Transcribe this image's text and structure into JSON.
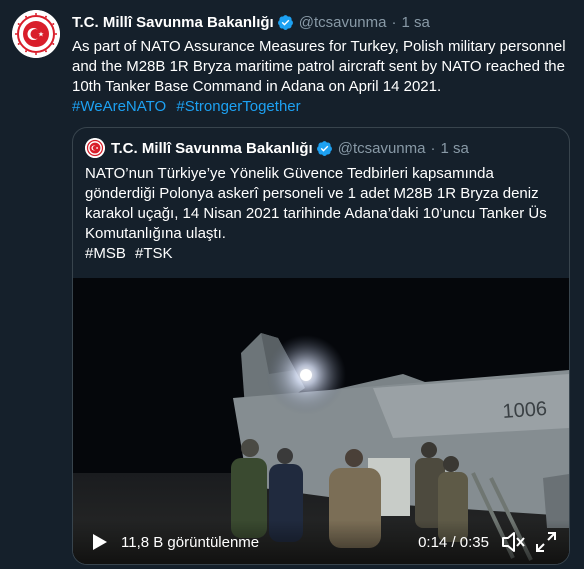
{
  "tweet": {
    "author_name": "T.C. Millî Savunma Bakanlığı",
    "handle": "@tcsavunma",
    "separator": "·",
    "time": "1 sa",
    "text": "As part of NATO Assurance Measures for Turkey, Polish military personnel and the M28B 1R Bryza maritime patrol aircraft sent by NATO reached the 10th Tanker Base Command in Adana on April 14 2021.",
    "hashtags": [
      "#WeAreNATO",
      "#StrongerTogether"
    ]
  },
  "quote": {
    "author_name": "T.C. Millî Savunma Bakanlığı",
    "handle": "@tcsavunma",
    "separator": "·",
    "time": "1 sa",
    "text": "NATO’nun Türkiye’ye Yönelik Güvence Tedbirleri kapsamında gönderdiği Polonya askerî personeli ve 1 adet M28B 1R Bryza deniz karakol uçağı, 14 Nisan 2021 tarihinde Adana’daki 10’uncu Tanker Üs Komutanlığına ulaştı.",
    "hashtags": [
      "#MSB",
      "#TSK"
    ]
  },
  "video": {
    "views": "11,8 B görüntülenme",
    "current_time": "0:14",
    "time_separator": " / ",
    "duration": "0:35",
    "icons": [
      "play-icon",
      "volume-muted-icon",
      "fullscreen-icon"
    ]
  },
  "colors": {
    "background": "#15202b",
    "text": "#ffffff",
    "secondary": "#8899a6",
    "link": "#1da1f2",
    "border": "#38444d",
    "verified": "#1da1f2",
    "logo_red": "#d91e2b"
  }
}
